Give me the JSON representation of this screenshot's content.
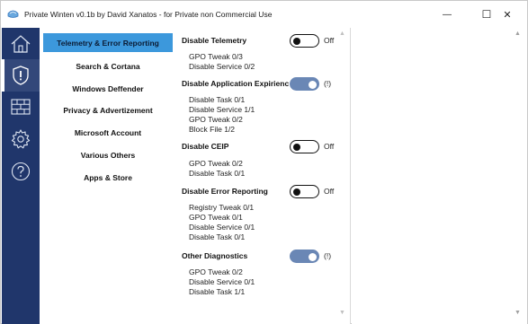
{
  "window": {
    "title": "Private Winten v0.1b by David Xanatos - for Private non Commercial Use",
    "minimize_glyph": "—",
    "maximize_glyph": "☐",
    "close_glyph": "✕"
  },
  "rail": {
    "items": [
      {
        "icon": "home-icon",
        "active": false
      },
      {
        "icon": "shield-icon",
        "active": true
      },
      {
        "icon": "firewall-icon",
        "active": false
      },
      {
        "icon": "gear-icon",
        "active": false
      },
      {
        "icon": "help-icon",
        "active": false
      }
    ],
    "colors": {
      "background": "#20366b",
      "active": "#33487a"
    }
  },
  "categories": {
    "items": [
      {
        "label": "Telemetry & Error Reporting",
        "active": true
      },
      {
        "label": "Search & Cortana",
        "active": false
      },
      {
        "label": "Windows Deffender",
        "active": false
      },
      {
        "label": "Privacy & Advertizement",
        "active": false
      },
      {
        "label": "Microsoft Account",
        "active": false
      },
      {
        "label": "Various Others",
        "active": false
      },
      {
        "label": "Apps & Store",
        "active": false
      }
    ],
    "active_color": "#3c98dc"
  },
  "settings": {
    "sections": [
      {
        "title": "Disable Telemetry",
        "toggle_state": "off",
        "toggle_label": "Off",
        "details": [
          "GPO Tweak 0/3",
          "Disable Service 0/2"
        ]
      },
      {
        "title": "Disable Application Expirienc",
        "toggle_state": "on",
        "toggle_label": "(!)",
        "details": [
          "Disable Task 0/1",
          "Disable Service 1/1",
          "GPO Tweak 0/2",
          "Block File 1/2"
        ]
      },
      {
        "title": "Disable CEIP",
        "toggle_state": "off",
        "toggle_label": "Off",
        "details": [
          "GPO Tweak 0/2",
          "Disable Task 0/1"
        ]
      },
      {
        "title": "Disable Error Reporting",
        "toggle_state": "off",
        "toggle_label": "Off",
        "details": [
          "Registry Tweak 0/1",
          "GPO Tweak 0/1",
          "Disable Service 0/1",
          "Disable Task 0/1"
        ]
      },
      {
        "title": "Other Diagnostics",
        "toggle_state": "on",
        "toggle_label": "(!)",
        "details": [
          "GPO Tweak 0/2",
          "Disable Service 0/1",
          "Disable Task 1/1"
        ]
      }
    ],
    "toggle_on_color": "#6a87b5"
  },
  "scroll": {
    "up_glyph": "▲",
    "down_glyph": "▼"
  }
}
